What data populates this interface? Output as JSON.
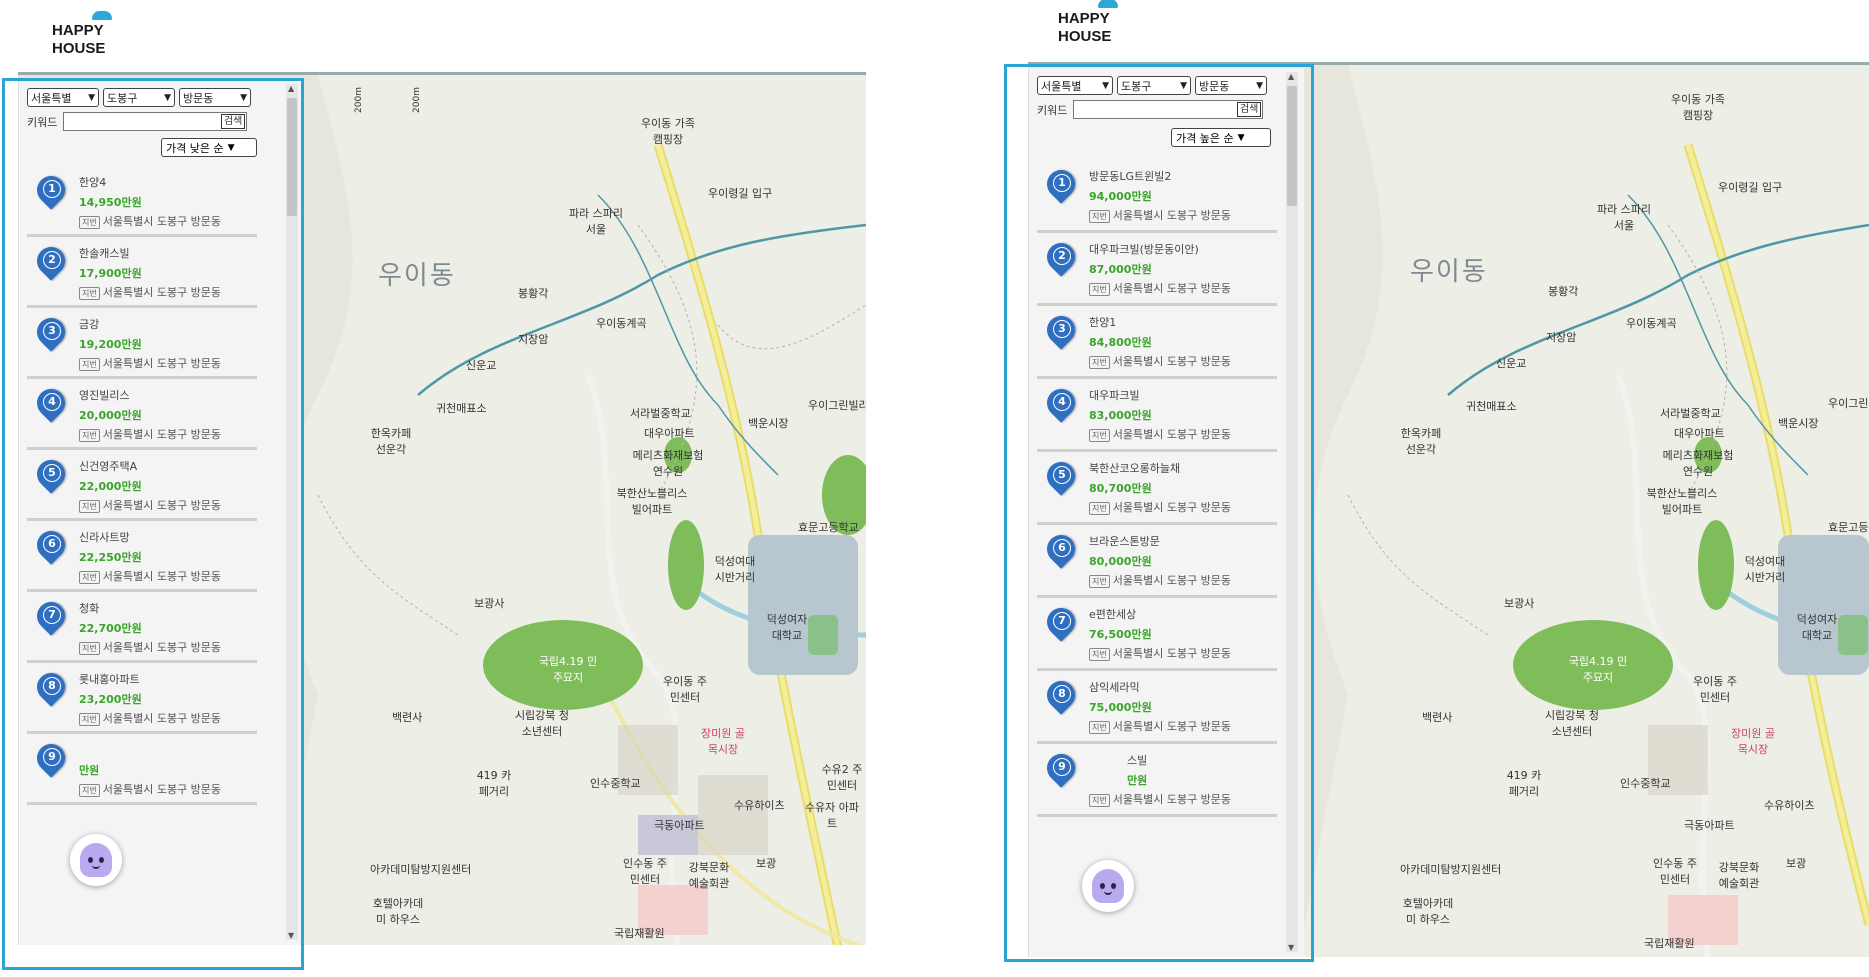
{
  "logo": {
    "line1": "HAPPY",
    "line2": "HOUSE"
  },
  "colors": {
    "highlight": "#2aa3d6",
    "price": "#3aa52a",
    "pin": "#2f6fc2",
    "chatbot": "#b9a9ee"
  },
  "panels": [
    {
      "filters": {
        "city": "서울특별",
        "district": "도봉구",
        "dong": "방문동"
      },
      "keyword_label": "키워드",
      "keyword_value": "",
      "search_label": "검색",
      "sort_label": "가격 낮은 순",
      "items": [
        {
          "num": "1",
          "name": "한양4",
          "price": "14,950만원",
          "addr": "서울특별시 도봉구 방문동"
        },
        {
          "num": "2",
          "name": "한솔캐스빌",
          "price": "17,900만원",
          "addr": "서울특별시 도봉구 방문동"
        },
        {
          "num": "3",
          "name": "금강",
          "price": "19,200만원",
          "addr": "서울특별시 도봉구 방문동"
        },
        {
          "num": "4",
          "name": "영진빌리스",
          "price": "20,000만원",
          "addr": "서울특별시 도봉구 방문동"
        },
        {
          "num": "5",
          "name": "신건영주택A",
          "price": "22,000만원",
          "addr": "서울특별시 도봉구 방문동"
        },
        {
          "num": "6",
          "name": "신라사트망",
          "price": "22,250만원",
          "addr": "서울특별시 도봉구 방문동"
        },
        {
          "num": "7",
          "name": "청화",
          "price": "22,700만원",
          "addr": "서울특별시 도봉구 방문동"
        },
        {
          "num": "8",
          "name": "롯내홍아파트",
          "price": "23,200만원",
          "addr": "서울특별시 도봉구 방문동"
        },
        {
          "num": "9",
          "name": "",
          "price": "만원",
          "addr": "서울특별시 도봉구 방문동"
        }
      ]
    },
    {
      "filters": {
        "city": "서울특별",
        "district": "도봉구",
        "dong": "방문동"
      },
      "keyword_label": "키워드",
      "keyword_value": "",
      "search_label": "검색",
      "sort_label": "가격 높은 순",
      "items": [
        {
          "num": "1",
          "name": "방문동LG트윈빌2",
          "price": "94,000만원",
          "addr": "서울특별시 도봉구 방문동"
        },
        {
          "num": "2",
          "name": "대우파크빌(방문동이안)",
          "price": "87,000만원",
          "addr": "서울특별시 도봉구 방문동"
        },
        {
          "num": "3",
          "name": "한양1",
          "price": "84,800만원",
          "addr": "서울특별시 도봉구 방문동"
        },
        {
          "num": "4",
          "name": "대우파크빌",
          "price": "83,000만원",
          "addr": "서울특별시 도봉구 방문동"
        },
        {
          "num": "5",
          "name": "북한산코오롱하늘채",
          "price": "80,700만원",
          "addr": "서울특별시 도봉구 방문동"
        },
        {
          "num": "6",
          "name": "브라운스톤방문",
          "price": "80,000만원",
          "addr": "서울특별시 도봉구 방문동"
        },
        {
          "num": "7",
          "name": "e편한세상",
          "price": "76,500만원",
          "addr": "서울특별시 도봉구 방문동"
        },
        {
          "num": "8",
          "name": "삼익세라믹",
          "price": "75,000만원",
          "addr": "서울특별시 도봉구 방문동"
        },
        {
          "num": "9",
          "name": "스빌",
          "price": "만원",
          "addr": "서울특별시 도봉구 방문동"
        }
      ]
    }
  ],
  "map_labels": {
    "uidong": "우이동",
    "uidong_campground": "우이동 가족캠핑장",
    "uiryeong": "우이령길 입구",
    "paragon": "파라 스파리서울",
    "bonghwang": "봉황각",
    "jijang": "지장암",
    "sinsungyo": "신운교",
    "uidong_gyegok": "우이동계곡",
    "gwicheon": "귀천매표소",
    "hanok_cafe": "한옥카페 선운각",
    "seorabeol": "서라벌중학교",
    "daewoo_apt": "대우아파트",
    "merits": "메리츠화재보험 연수원",
    "bukhansan_villa": "북한산노블리스 빌어파트",
    "baekun": "백운시장",
    "uigreen": "우이그린빌라",
    "hyomun": "효문고등학교",
    "duksung_street": "덕성여대 시반거리",
    "duksung_univ": "덕성여자 대학교",
    "bogwangsa": "보광사",
    "april19": "국립4.19 민주묘지",
    "uidong_center": "우이동 주민센터",
    "gangbuk_youth": "시립강북 청소년센터",
    "baekunsa": "백련사",
    "cafe_street": "419 카페거리",
    "insu_middle": "인수중학교",
    "suyu_hyundai": "수유하이츠",
    "academy": "아카데미탐방지원센터",
    "hotel_academy": "호텔아카데미 하우스",
    "insudong_center": "인수동 주민센터",
    "gangbuk_art": "강북문화 예술회관",
    "national_cemetery": "국립재활원",
    "guksa": "극동아파트",
    "sangmi": "장미원 골목시장",
    "boryeong": "보광",
    "suyu2": "수유2 주민센터",
    "suyu_ja": "수유자 아파트",
    "alt1": "200m",
    "alt2": "200m"
  }
}
